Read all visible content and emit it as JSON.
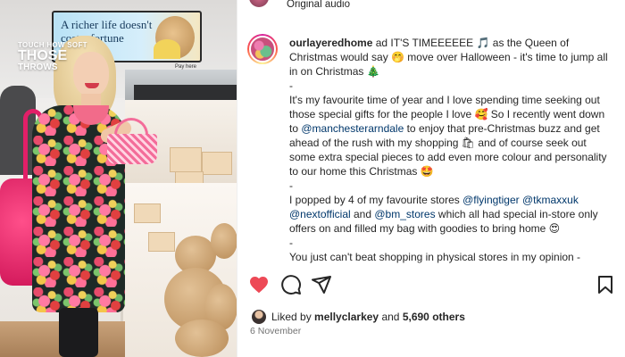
{
  "media": {
    "ad_headline": "A richer life doesn't cost a fortune",
    "promo_line1": "TOUCH HOW SOFT",
    "promo_line2": "THOSE",
    "promo_line3": "THROWS",
    "sign_text": "Pay here"
  },
  "top": {
    "audio_label": "Original audio"
  },
  "post": {
    "username": "ourlayeredhome",
    "paragraphs": [
      [
        {
          "t": "ad IT'S TIMEEEEEE 🎵 as the Queen of Christmas would say 🤭 move over Halloween - it's time to jump all in on Christmas 🎄"
        }
      ],
      [
        {
          "t": "-"
        }
      ],
      [
        {
          "t": "It's my favourite time of year and I love spending time seeking out those special gifts for the people I love 🥰 So I recently went down to "
        },
        {
          "t": "@manchesterarndale",
          "m": true
        },
        {
          "t": " to enjoy that pre-Christmas buzz and get ahead of the rush with my shopping 🛍 and of course seek out some extra special pieces to add even more colour and personality to our home this Christmas 🤩"
        }
      ],
      [
        {
          "t": "-"
        }
      ],
      [
        {
          "t": "I popped by 4 of my favourite stores "
        },
        {
          "t": "@flyingtiger",
          "m": true
        },
        {
          "t": " "
        },
        {
          "t": "@tkmaxxuk",
          "m": true
        },
        {
          "t": " "
        },
        {
          "t": "@nextofficial",
          "m": true
        },
        {
          "t": " and "
        },
        {
          "t": "@bm_stores",
          "m": true
        },
        {
          "t": " which all had special in-store only offers on and filled my bag with goodies to bring home 😍"
        }
      ],
      [
        {
          "t": "-"
        }
      ],
      [
        {
          "t": "You just can't beat shopping in physical stores in my opinion -"
        }
      ]
    ]
  },
  "actions": {
    "like_icon": "heart-filled-icon",
    "comment_icon": "comment-icon",
    "share_icon": "share-icon",
    "save_icon": "bookmark-icon",
    "like_color": "#ed4956"
  },
  "likes": {
    "prefix": "Liked by",
    "user": "mellyclarkey",
    "connector": "and",
    "others": "5,690 others"
  },
  "date": "6 November"
}
